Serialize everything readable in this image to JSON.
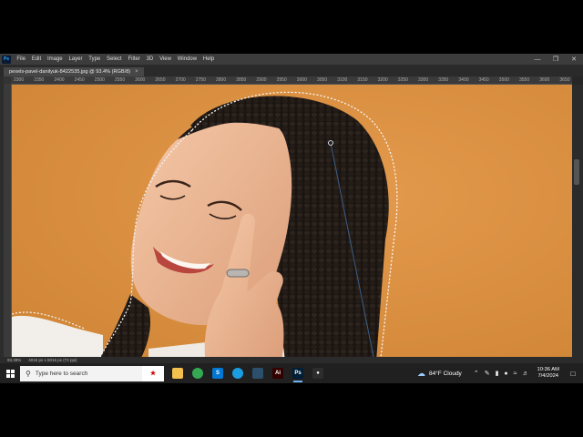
{
  "app": {
    "logo": "Ps"
  },
  "menu": [
    "File",
    "Edit",
    "Image",
    "Layer",
    "Type",
    "Select",
    "Filter",
    "3D",
    "View",
    "Window",
    "Help"
  ],
  "window_controls": [
    "—",
    "❐",
    "✕"
  ],
  "document": {
    "tab_title": "pexels-pavel-danilyuk-8422535.jpg @ 93.4% (RGB/8)",
    "tab_close": "×"
  },
  "ruler_labels": [
    "2300",
    "2350",
    "2400",
    "2450",
    "2500",
    "2550",
    "2600",
    "2650",
    "2700",
    "2750",
    "2800",
    "2850",
    "2900",
    "2950",
    "3000",
    "3050",
    "3100",
    "3150",
    "3200",
    "3250",
    "3300",
    "3350",
    "3400",
    "3450",
    "3500",
    "3550",
    "3600",
    "3650"
  ],
  "status": {
    "zoom": "93.38%",
    "doc_info": "4016 px x 6016 px (72 ppi)"
  },
  "taskbar": {
    "search_placeholder": "Type here to search",
    "apps": [
      {
        "name": "file-explorer-icon",
        "color": "#f2c14e",
        "glyph": ""
      },
      {
        "name": "chrome-icon",
        "color": "#34a853",
        "glyph": ""
      },
      {
        "name": "skype-icon",
        "color": "#0078d4",
        "glyph": "S"
      },
      {
        "name": "edge-icon",
        "color": "#1b9de2",
        "glyph": ""
      },
      {
        "name": "app-icon",
        "color": "#2c4f6b",
        "glyph": ""
      },
      {
        "name": "illustrator-icon",
        "color": "#330000",
        "glyph": "Ai"
      },
      {
        "name": "photoshop-icon",
        "color": "#001e36",
        "glyph": "Ps"
      },
      {
        "name": "recorder-icon",
        "color": "#2d2d2d",
        "glyph": "●"
      }
    ],
    "weather": {
      "temp": "84°F",
      "condition": "Cloudy"
    },
    "time": "10:36 AM",
    "date": "7/4/2024"
  },
  "colors": {
    "canvas_bg": "#d98f42",
    "accent": "#6fb1f5"
  }
}
